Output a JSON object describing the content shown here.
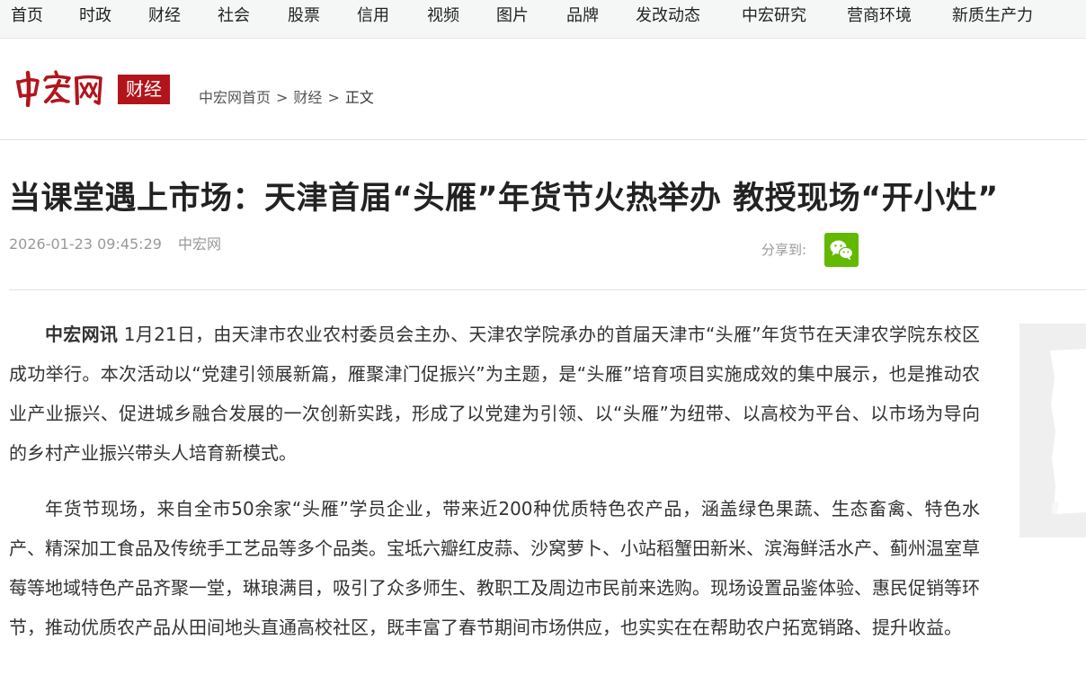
{
  "nav": {
    "items": [
      {
        "label": "首页"
      },
      {
        "label": "时政"
      },
      {
        "label": "财经"
      },
      {
        "label": "社会"
      },
      {
        "label": "股票"
      },
      {
        "label": "信用"
      },
      {
        "label": "视频"
      },
      {
        "label": "图片"
      },
      {
        "label": "品牌"
      },
      {
        "label": "发改动态"
      },
      {
        "label": "中宏研究"
      },
      {
        "label": "营商环境"
      },
      {
        "label": "新质生产力"
      }
    ]
  },
  "header": {
    "logo_text": "中宏网",
    "channel": "财经",
    "brand_color": "#b3141c",
    "breadcrumb": {
      "home": "中宏网首页",
      "section": "财经",
      "current": "正文",
      "separator": ">"
    }
  },
  "article": {
    "title": "当课堂遇上市场：天津首届“头雁”年货节火热举办 教授现场“开小灶”",
    "date": "2026-01-23 09:45:29",
    "source": "中宏网",
    "share_label": "分享到:",
    "share_icon": "wechat-icon",
    "share_color": "#62b900",
    "lead": "中宏网讯",
    "paragraph1": "1月21日，由天津市农业农村委员会主办、天津农学院承办的首届天津市“头雁”年货节在天津农学院东校区成功举行。本次活动以“党建引领展新篇，雁聚津门促振兴”为主题，是“头雁”培育项目实施成效的集中展示，也是推动农业产业振兴、促进城乡融合发展的一次创新实践，形成了以党建为引领、以“头雁”为纽带、以高校为平台、以市场为导向的乡村产业振兴带头人培育新模式。",
    "paragraph2": "年货节现场，来自全市50余家“头雁”学员企业，带来近200种优质特色农产品，涵盖绿色果蔬、生态畜禽、特色水产、精深加工食品及传统手工艺品等多个品类。宝坻六瓣红皮蒜、沙窝萝卜、小站稻蟹田新米、滨海鲜活水产、蓟州温室草莓等地域特色产品齐聚一堂，琳琅满目，吸引了众多师生、教职工及周边市民前来选购。现场设置品鉴体验、惠民促销等环节，推动优质农产品从田间地头直通高校社区，既丰富了春节期间市场供应，也实实在在帮助农户拓宽销路、提升收益。"
  }
}
